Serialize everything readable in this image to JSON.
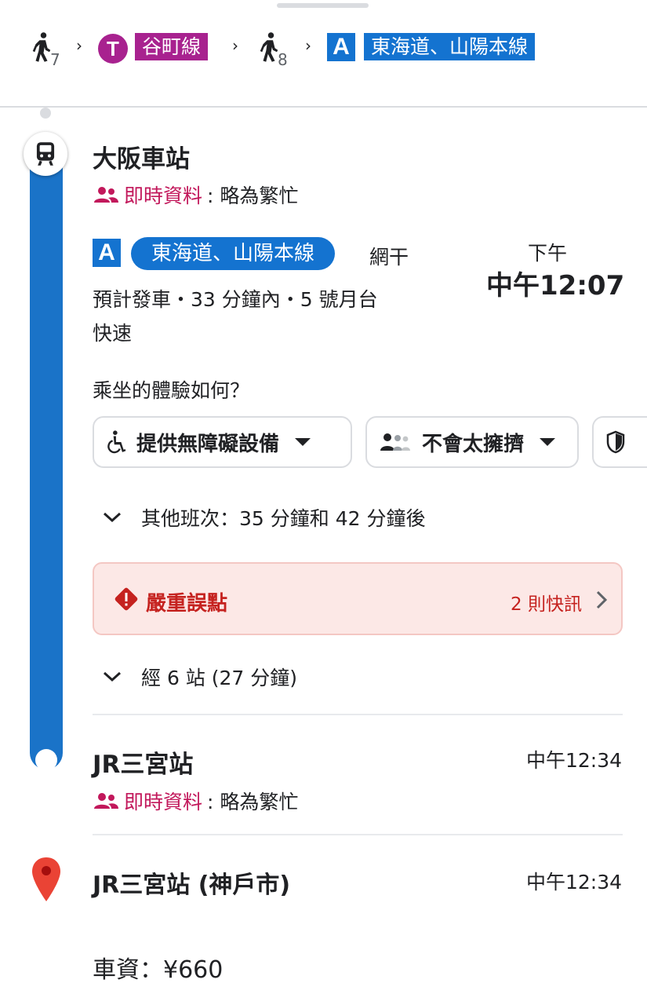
{
  "summary": {
    "walk1_minutes": "7",
    "t_badge": "T",
    "t_line": "谷町線",
    "walk2_minutes": "8",
    "a_badge": "A",
    "a_line": "東海道、山陽本線",
    "separator": "›"
  },
  "departure": {
    "station": "大阪車站",
    "live_label": "即時資料",
    "live_value": ": 略為繁忙",
    "line_badge": "A",
    "line_name": "東海道、山陽本線",
    "direction": "網干",
    "time_prefix": "下午",
    "time": "中午12:07",
    "details": "預計發車・33 分鐘內・5 號月台",
    "service": "快速",
    "feedback_question": "乘坐的體驗如何？",
    "chips": [
      "提供無障礙設備",
      "不會太擁擠"
    ],
    "other_departures": "其他班次：35 分鐘和 42 分鐘後"
  },
  "alert": {
    "title": "嚴重誤點",
    "link": "2 則快訊"
  },
  "stops_summary": "經 6 站 (27 分鐘)",
  "arrival": {
    "station": "JR三宮站",
    "time": "中午12:34",
    "live_label": "即時資料",
    "live_value": ": 略為繁忙"
  },
  "destination": {
    "name": "JR三宮站 (神戶市)",
    "time": "中午12:34"
  },
  "fare": "車資：¥660",
  "colors": {
    "rail_blue": "#1a73c8",
    "line_blue": "#1473d0",
    "tanimachi_purple": "#a8228f",
    "alert_red": "#c5221f",
    "live_pink": "#c2185b"
  }
}
